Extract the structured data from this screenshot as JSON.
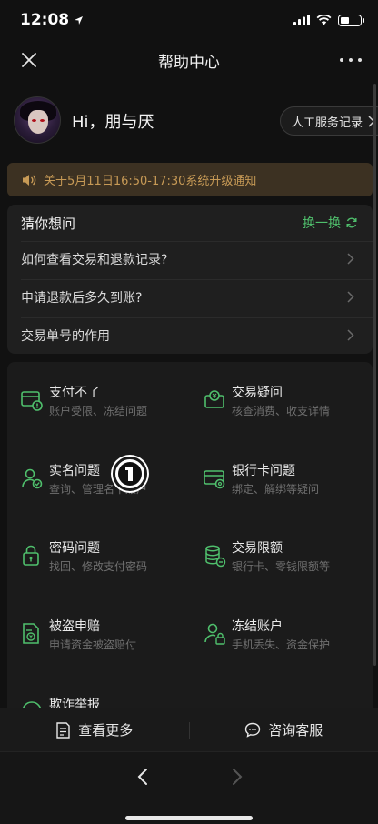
{
  "status_bar": {
    "time": "12:08"
  },
  "nav": {
    "title": "帮助中心"
  },
  "user": {
    "greeting": "Hi，朋与厌",
    "service_record_label": "人工服务记录"
  },
  "notice": {
    "text": "关于5月11日16:50-17:30系统升级通知"
  },
  "guess": {
    "title": "猜你想问",
    "refresh_label": "换一换",
    "items": [
      {
        "label": "如何查看交易和退款记录?"
      },
      {
        "label": "申请退款后多久到账?"
      },
      {
        "label": "交易单号的作用"
      }
    ]
  },
  "topics": [
    {
      "title": "支付不了",
      "desc": "账户受限、冻结问题",
      "icon": "payment-failed-icon"
    },
    {
      "title": "交易疑问",
      "desc": "核查消费、收支详情",
      "icon": "transaction-query-icon"
    },
    {
      "title": "实名问题",
      "desc": "查询、管理名下账户",
      "icon": "real-name-icon"
    },
    {
      "title": "银行卡问题",
      "desc": "绑定、解绑等疑问",
      "icon": "bank-card-icon"
    },
    {
      "title": "密码问题",
      "desc": "找回、修改支付密码",
      "icon": "password-lock-icon"
    },
    {
      "title": "交易限额",
      "desc": "银行卡、零钱限额等",
      "icon": "coin-stack-icon"
    },
    {
      "title": "被盗申赔",
      "desc": "申请资金被盗赔付",
      "icon": "theft-claim-icon"
    },
    {
      "title": "冻结账户",
      "desc": "手机丢失、资金保护",
      "icon": "freeze-account-icon"
    },
    {
      "title": "欺诈举报",
      "desc": "",
      "icon": "fraud-report-icon"
    }
  ],
  "bottom_actions": {
    "more_label": "查看更多",
    "contact_label": "咨询客服"
  },
  "colors": {
    "accent_green": "#4fbf6c",
    "notice_text": "#c79a56",
    "notice_bg": "#3c3122"
  }
}
